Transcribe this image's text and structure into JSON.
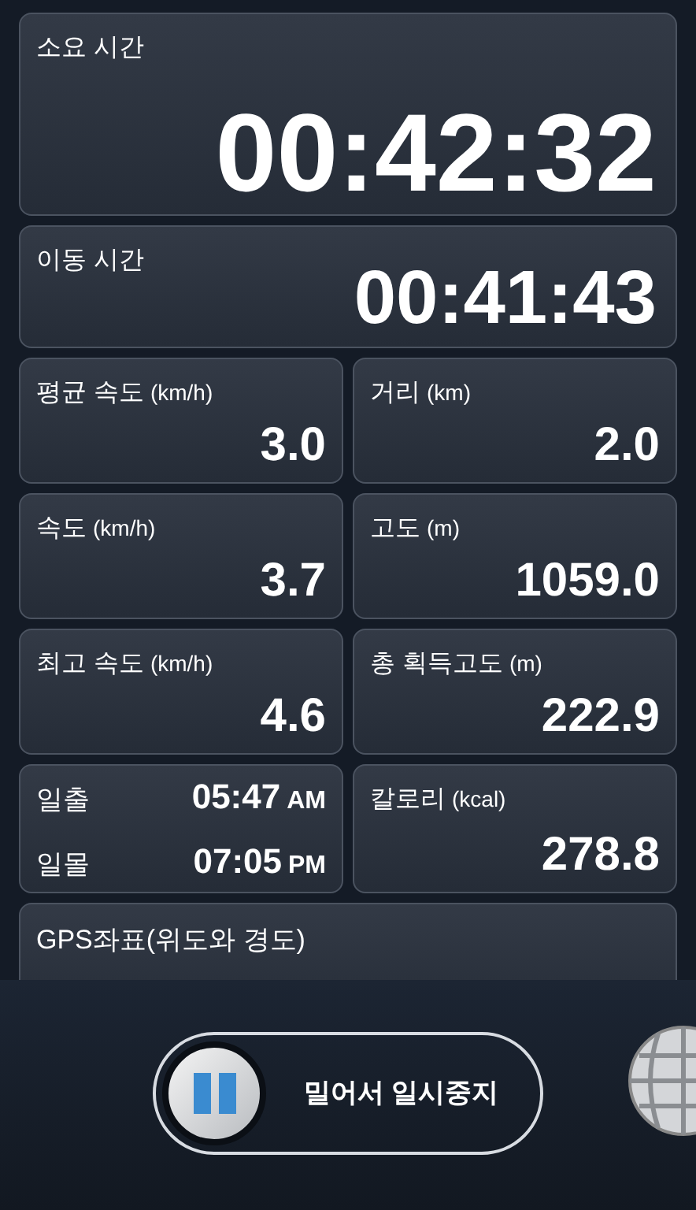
{
  "elapsed": {
    "label": "소요 시간",
    "value": "00:42:32"
  },
  "moving": {
    "label": "이동 시간",
    "value": "00:41:43"
  },
  "stats": [
    {
      "label": "평균 속도",
      "unit": "(km/h)",
      "value": "3.0"
    },
    {
      "label": "거리",
      "unit": "(km)",
      "value": "2.0"
    },
    {
      "label": "속도",
      "unit": "(km/h)",
      "value": "3.7"
    },
    {
      "label": "고도",
      "unit": "(m)",
      "value": "1059.0"
    },
    {
      "label": "최고 속도",
      "unit": "(km/h)",
      "value": "4.6"
    },
    {
      "label": "총 획득고도",
      "unit": "(m)",
      "value": "222.9"
    }
  ],
  "sun": [
    {
      "label": "일출",
      "time": "05:47",
      "ampm": "AM"
    },
    {
      "label": "일몰",
      "time": "07:05",
      "ampm": "PM"
    }
  ],
  "calories": {
    "label": "칼로리",
    "unit": "(kcal)",
    "value": "278.8"
  },
  "gps": {
    "label": "GPS좌표(위도와 경도)"
  },
  "slider": {
    "label": "밀어서 일시중지"
  }
}
